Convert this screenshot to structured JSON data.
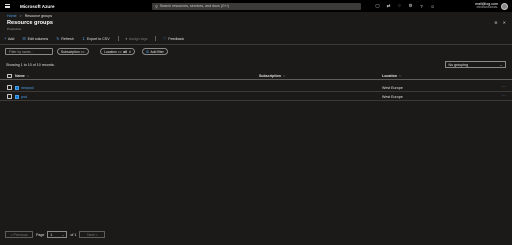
{
  "topbar": {
    "brand": "Microsoft Azure",
    "search_placeholder": "Search resources, services, and docs (G+/)",
    "icons": [
      "cloud-shell-icon",
      "directory-filter-icon",
      "notifications-icon",
      "settings-icon",
      "help-icon",
      "feedback-icon"
    ],
    "account_email": "mail@log.com",
    "account_tier": "PROFESSIONAL"
  },
  "breadcrumb": {
    "home": "Home",
    "current": "Resource groups",
    "separator": ">"
  },
  "page": {
    "title": "Resource groups",
    "subtitle": "Production"
  },
  "commands": {
    "add": "Add",
    "edit_columns": "Edit columns",
    "refresh": "Refresh",
    "export_csv": "Export to CSV",
    "assign_tags": "Assign tags",
    "feedback": "Feedback"
  },
  "filters": {
    "filter_placeholder": "Filter by name...",
    "subscription_label": "Subscription ==",
    "location_label": "Location ==",
    "location_value": "all",
    "add_filter": "Add filter"
  },
  "records_text": "Showing 1 to 10 of 10 records.",
  "grouping": {
    "selected": "No grouping"
  },
  "table": {
    "columns": {
      "name": "Name",
      "subscription": "Subscription",
      "location": "Location"
    },
    "rows": [
      {
        "name": "newpod",
        "location": "West Europe"
      },
      {
        "name": "pod",
        "location": "West Europe"
      }
    ]
  },
  "pager": {
    "previous": "< Previous",
    "page_label": "Page",
    "page_value": "1",
    "of_label": "of 1",
    "next": "Next >"
  },
  "colors": {
    "accent": "#4f9fe8",
    "background": "#1b1a19",
    "topbar": "#000000"
  }
}
